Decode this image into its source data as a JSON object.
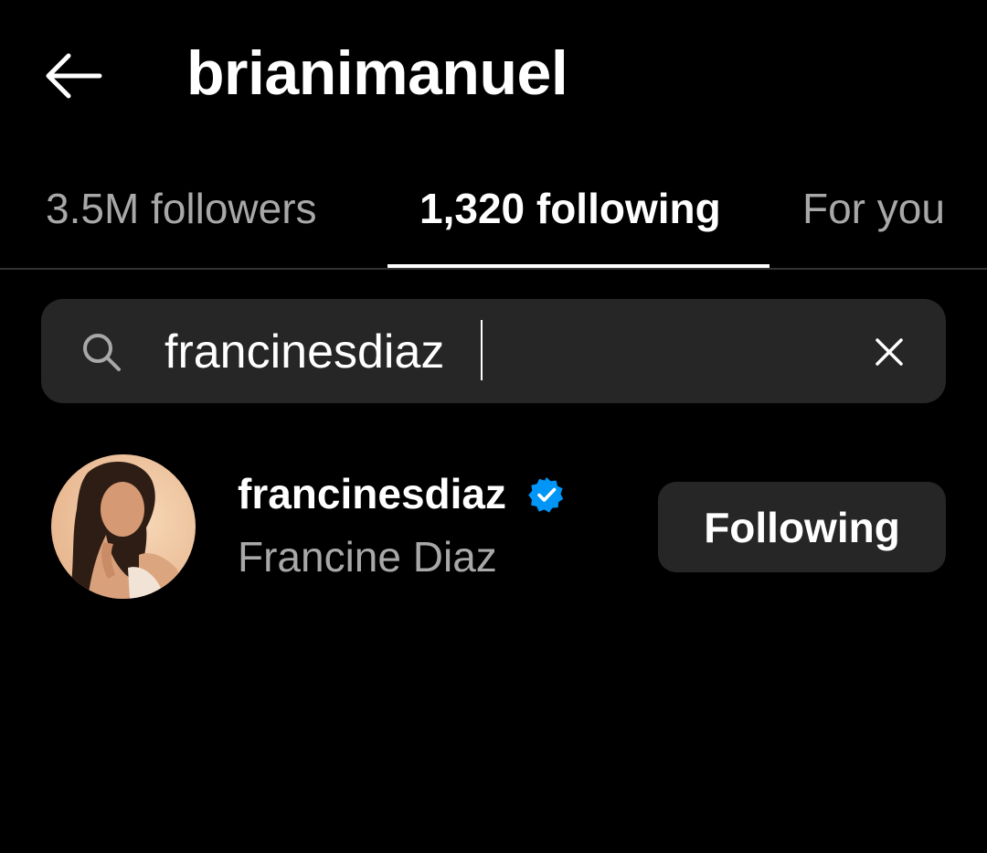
{
  "header": {
    "back_icon": "arrow-left-icon",
    "title": "brianimanuel"
  },
  "tabs": [
    {
      "label": "3.5M followers",
      "active": false
    },
    {
      "label": "1,320 following",
      "active": true
    },
    {
      "label": "For you",
      "active": false
    }
  ],
  "search": {
    "icon": "search-icon",
    "value": "francinesdiaz",
    "clear_icon": "close-icon"
  },
  "results": [
    {
      "username": "francinesdiaz",
      "verified": true,
      "full_name": "Francine Diaz",
      "button_label": "Following",
      "avatar_icon": "profile-photo"
    }
  ],
  "colors": {
    "background": "#000000",
    "text_primary": "#ffffff",
    "text_secondary": "#a8a8a8",
    "surface": "#262626",
    "verified_blue": "#0095f6"
  }
}
